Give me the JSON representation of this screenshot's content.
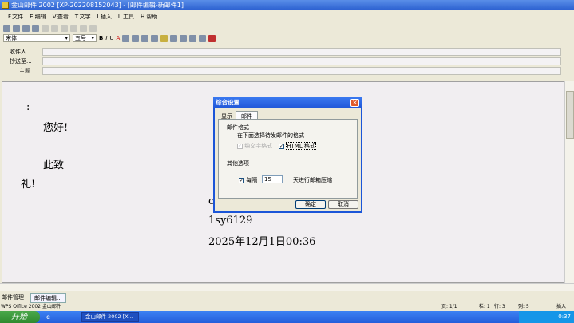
{
  "window": {
    "title": "金山邮件 2002 [XP-202208152043] - [邮件编辑-新邮件1]"
  },
  "menu": [
    "F.文件",
    "E.编辑",
    "V.查看",
    "T.文字",
    "I.插入",
    "L.工具",
    "H.帮助"
  ],
  "format": {
    "font": "宋体",
    "size": "五号"
  },
  "fields": {
    "to_label": "收件人...",
    "cc_label": "抄送至...",
    "subject_label": "主题"
  },
  "body": {
    "line1": ":",
    "line2": "您好!",
    "line3": "此致",
    "line4": "礼!",
    "sig_partial": "c",
    "sig_name": "1sy6129",
    "sig_date": "2025年12月1日00:36"
  },
  "dialog": {
    "title": "综合设置",
    "tabs": [
      "显示",
      "邮件"
    ],
    "group1": "邮件格式",
    "desc": "在下面选择待发邮件的格式",
    "opt_plain": "纯文字格式",
    "opt_html": "HTML 格式",
    "group2": "其他选项",
    "interval_label": "每隔",
    "interval_value": "15",
    "interval_suffix": "天进行邮箱压缩",
    "ok": "确定",
    "cancel": "取消"
  },
  "tabs": [
    "邮件管理",
    "邮件编辑..."
  ],
  "status": {
    "app": "WPS Office 2002 金山邮件",
    "page": "页: 1/1",
    "col": "栏: 1",
    "row": "行: 3",
    "column": "列: 5",
    "ins": "插入"
  },
  "taskbar": {
    "start": "开始",
    "task": "金山邮件 2002 [X...",
    "clock": "0:37"
  }
}
